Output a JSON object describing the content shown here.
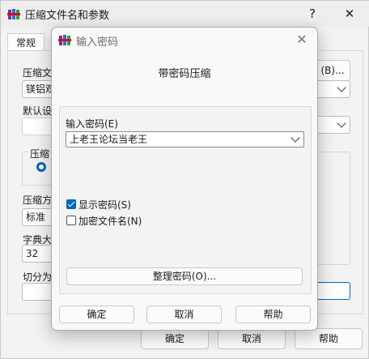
{
  "bg_window": {
    "title": "压缩文件名和参数",
    "help_glyph": "?",
    "close_glyph": "✕",
    "tab_general": "常规",
    "archive_name_label": "压缩文",
    "archive_name_value": "镁铝观",
    "default_settings_label": "默认设",
    "browse_button": "(B)...",
    "archive_format_label": "压缩",
    "method_label": "压缩方",
    "method_value": "标准",
    "dict_label": "字典大",
    "dict_value": "32",
    "split_label": "切分为",
    "ok": "确定",
    "cancel": "取消",
    "help": "帮助"
  },
  "dialog": {
    "title": "输入密码",
    "close_glyph": "✕",
    "header": "带密码压缩",
    "password_label": "输入密码(E)",
    "password_value": "上老王论坛当老王",
    "show_password": {
      "label": "显示密码(S)",
      "checked": true
    },
    "encrypt_names": {
      "label": "加密文件名(N)",
      "checked": false
    },
    "organize_button": "整理密码(O)...",
    "ok": "确定",
    "cancel": "取消",
    "help": "帮助"
  },
  "colors": {
    "accent": "#0067c0"
  },
  "icons": {
    "app": "winrar-books-icon",
    "dropdown": "chevron-down-icon",
    "radio": "radio-selected-icon",
    "check": "checkmark-icon"
  }
}
